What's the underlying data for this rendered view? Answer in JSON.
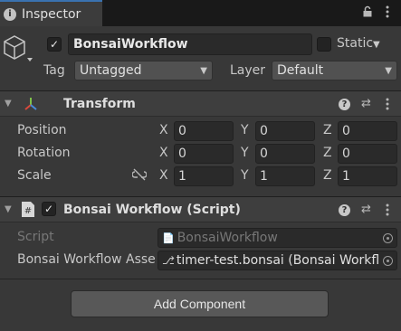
{
  "tab": {
    "title": "Inspector",
    "icons": [
      "info-icon",
      "lock-icon",
      "kebab-menu-icon"
    ]
  },
  "object": {
    "active": true,
    "name": "BonsaiWorkflow",
    "static_label": "Static",
    "static_checked": false,
    "tag_label": "Tag",
    "tag_value": "Untagged",
    "layer_label": "Layer",
    "layer_value": "Default"
  },
  "transform": {
    "title": "Transform",
    "rows": [
      {
        "label": "Position",
        "x": "0",
        "y": "0",
        "z": "0"
      },
      {
        "label": "Rotation",
        "x": "0",
        "y": "0",
        "z": "0"
      },
      {
        "label": "Scale",
        "x": "1",
        "y": "1",
        "z": "1"
      }
    ],
    "axes": {
      "x": "X",
      "y": "Y",
      "z": "Z"
    }
  },
  "script_component": {
    "enabled": true,
    "title": "Bonsai Workflow (Script)",
    "script_label": "Script",
    "script_value": "BonsaiWorkflow",
    "asset_label": "Bonsai Workflow Asse",
    "asset_value": "timer-test.bonsai (Bonsai Workfl"
  },
  "add_component_label": "Add Component",
  "colors": {
    "accent": "#3a72b0",
    "background": "#383838"
  }
}
